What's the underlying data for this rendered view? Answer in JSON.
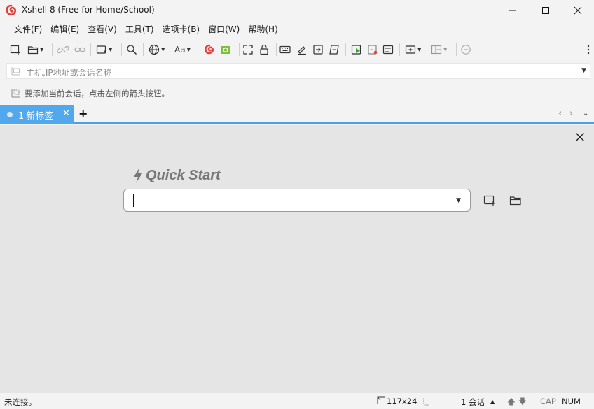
{
  "window": {
    "title": "Xshell 8 (Free for Home/School)",
    "controls": [
      "minimize",
      "maximize",
      "close"
    ]
  },
  "menu": [
    "文件(F)",
    "编辑(E)",
    "查看(V)",
    "工具(T)",
    "选项卡(B)",
    "窗口(W)",
    "帮助(H)"
  ],
  "toolbar": {
    "font_button_label": "Aa",
    "icons": [
      "new-session-icon",
      "open-folder-icon",
      "disconnect-icon",
      "reconnect-icon",
      "new-terminal-icon",
      "search-icon",
      "globe-icon",
      "font-icon",
      "xshell-icon",
      "xftp-icon",
      "fullscreen-icon",
      "lock-icon",
      "keyboard-icon",
      "highlight-pen-icon",
      "transfer-icon",
      "script-icon",
      "play-script-icon",
      "log-icon",
      "compose-icon",
      "add-tab-icon",
      "layout-icon",
      "chat-icon",
      "more-icon"
    ]
  },
  "address_bar": {
    "placeholder": "主机,IP地址或会话名称"
  },
  "hint": {
    "text": "要添加当前会话，点击左侧的箭头按钮。"
  },
  "tabs": {
    "items": [
      {
        "number": "1",
        "label": "新标签",
        "active": true
      }
    ],
    "add_label": "+"
  },
  "quick_start": {
    "title": "Quick Start",
    "input_value": ""
  },
  "status_bar": {
    "connection": "未连接。",
    "size": "117x24",
    "sessions": "1 会话",
    "caps": "CAP",
    "num": "NUM"
  },
  "colors": {
    "accent": "#52a8ec",
    "tab_border": "#4a9fe8",
    "main_bg": "#e5e5e5",
    "chrome_bg": "#f3f3f3"
  }
}
